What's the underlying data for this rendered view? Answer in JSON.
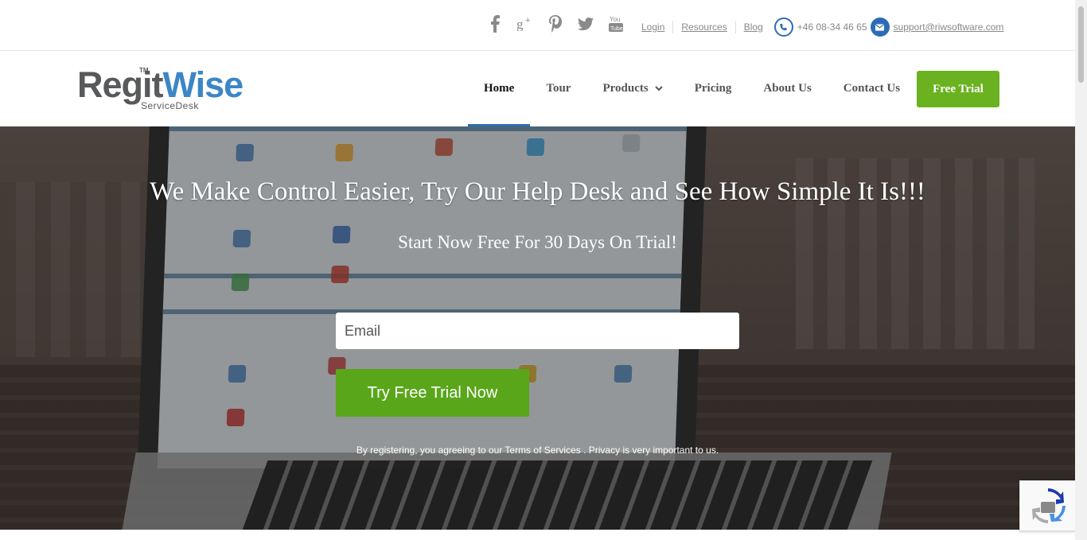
{
  "topbar": {
    "social": [
      "facebook-icon",
      "google-plus-icon",
      "pinterest-icon",
      "twitter-icon",
      "youtube-icon"
    ],
    "login": "Login",
    "resources": "Resources",
    "blog": "Blog",
    "phone": "+46 08-34 46 65",
    "email": "support@riwsoftware.com"
  },
  "logo": {
    "main_a": "Regit",
    "main_b": "Wise",
    "tm": "TM",
    "sub": "ServiceDesk"
  },
  "nav": {
    "home": "Home",
    "tour": "Tour",
    "products": "Products",
    "pricing": "Pricing",
    "about": "About Us",
    "contact": "Contact Us",
    "free_trial": "Free Trial"
  },
  "hero": {
    "headline": "We Make Control Easier, Try Our Help Desk and See How Simple It Is!!!",
    "subheadline": "Start Now Free For 30 Days On Trial!",
    "email_placeholder": "Email",
    "cta": "Try Free Trial Now",
    "legal_prefix": "By registering, you agreeing to our ",
    "terms": "Terms of Services",
    "legal_mid": " . ",
    "privacy": "Privacy",
    "legal_suffix": " is very important to us."
  },
  "colors": {
    "accent_green": "#5aa61b",
    "brand_blue": "#2d6cb5"
  }
}
